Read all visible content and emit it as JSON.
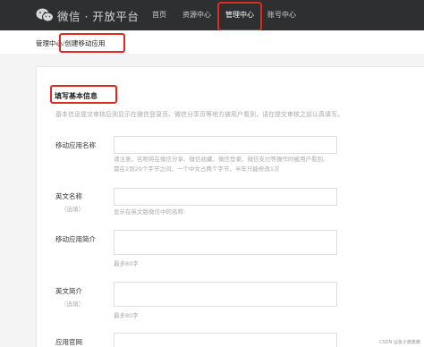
{
  "header": {
    "brand": "微信 · 开放平台",
    "logo_icon": "wechat-logo-icon",
    "nav": [
      {
        "label": "首页"
      },
      {
        "label": "资源中心"
      },
      {
        "label": "管理中心"
      },
      {
        "label": "账号中心"
      }
    ]
  },
  "breadcrumb": {
    "parent": "管理中心",
    "separator": "/",
    "current": "创建移动应用"
  },
  "section": {
    "title": "填写基本信息",
    "description": "基本信息提交审核后则显示在微信登录页、微信分享页等地方被用户看到，请在提交审核之前认真填写。"
  },
  "form": {
    "app_name_label": "移动应用名称",
    "app_name_hint_1": "请注意，名称将在微信分享、微信收藏、微信登录、微信支付等操作时被用户看到,",
    "app_name_hint_2": "需在2到20个字节之间，一个中文占两个字节，半年只能修改1次",
    "en_name_label": "英文名称",
    "en_name_optional": "（选填）",
    "en_name_hint": "显示在英文版微信中的名称",
    "intro_label": "移动应用简介",
    "intro_hint": "最多80字",
    "en_intro_label": "英文简介",
    "en_intro_optional": "（选填）",
    "en_intro_hint": "最多80字",
    "website_label": "应用官网"
  },
  "watermark": "CSDN @鱼子酱酱酱",
  "colors": {
    "topbar": "#2e2f31",
    "highlight": "#e02a20"
  }
}
